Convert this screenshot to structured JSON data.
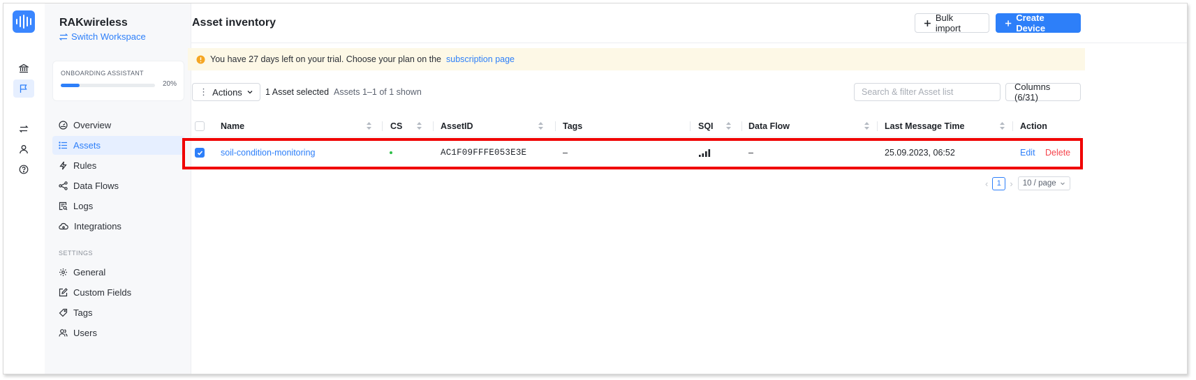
{
  "workspace": {
    "name": "RAKwireless",
    "switch_label": "Switch Workspace"
  },
  "onboarding": {
    "label": "ONBOARDING ASSISTANT",
    "percent_label": "20%",
    "progress": 0.2
  },
  "sidebar": {
    "items": [
      {
        "label": "Overview",
        "icon": "dashboard-icon"
      },
      {
        "label": "Assets",
        "icon": "list-icon",
        "active": true
      },
      {
        "label": "Rules",
        "icon": "bolt-icon"
      },
      {
        "label": "Data Flows",
        "icon": "share-icon"
      },
      {
        "label": "Logs",
        "icon": "file-search-icon"
      },
      {
        "label": "Integrations",
        "icon": "cloud-icon"
      }
    ],
    "settings_label": "SETTINGS",
    "settings_items": [
      {
        "label": "General",
        "icon": "gear-icon"
      },
      {
        "label": "Custom Fields",
        "icon": "edit-icon"
      },
      {
        "label": "Tags",
        "icon": "tag-icon"
      },
      {
        "label": "Users",
        "icon": "users-icon"
      }
    ]
  },
  "rail": {
    "icons": [
      "logo-icon",
      "bank-icon",
      "flag-icon",
      "swap-icon",
      "user-icon",
      "help-icon"
    ]
  },
  "header": {
    "title": "Asset inventory",
    "bulk_import": "Bulk import",
    "create_device": "Create Device"
  },
  "trial": {
    "text": "You have 27 days left on your trial. Choose your plan on the",
    "link": "subscription page"
  },
  "toolbar": {
    "actions": "Actions",
    "selected": "1 Asset selected",
    "range": "Assets 1–1 of 1 shown",
    "search_placeholder": "Search & filter Asset list",
    "columns": "Columns (6/31)"
  },
  "table": {
    "columns": [
      "Name",
      "CS",
      "AssetID",
      "Tags",
      "SQI",
      "Data Flow",
      "Last Message Time",
      "Action"
    ],
    "rows": [
      {
        "selected": true,
        "name": "soil-condition-monitoring",
        "cs_status": "online",
        "asset_id": "AC1F09FFFE053E3E",
        "tags": "–",
        "sqi_bars": 4,
        "data_flow": "–",
        "last_message_time": "25.09.2023, 06:52",
        "edit": "Edit",
        "delete": "Delete"
      }
    ]
  },
  "pagination": {
    "current_page": "1",
    "page_size": "10 / page"
  },
  "colors": {
    "primary": "#2d7ff9",
    "danger": "#f5434b",
    "highlight": "#f00000",
    "online": "#2fbf4a"
  }
}
